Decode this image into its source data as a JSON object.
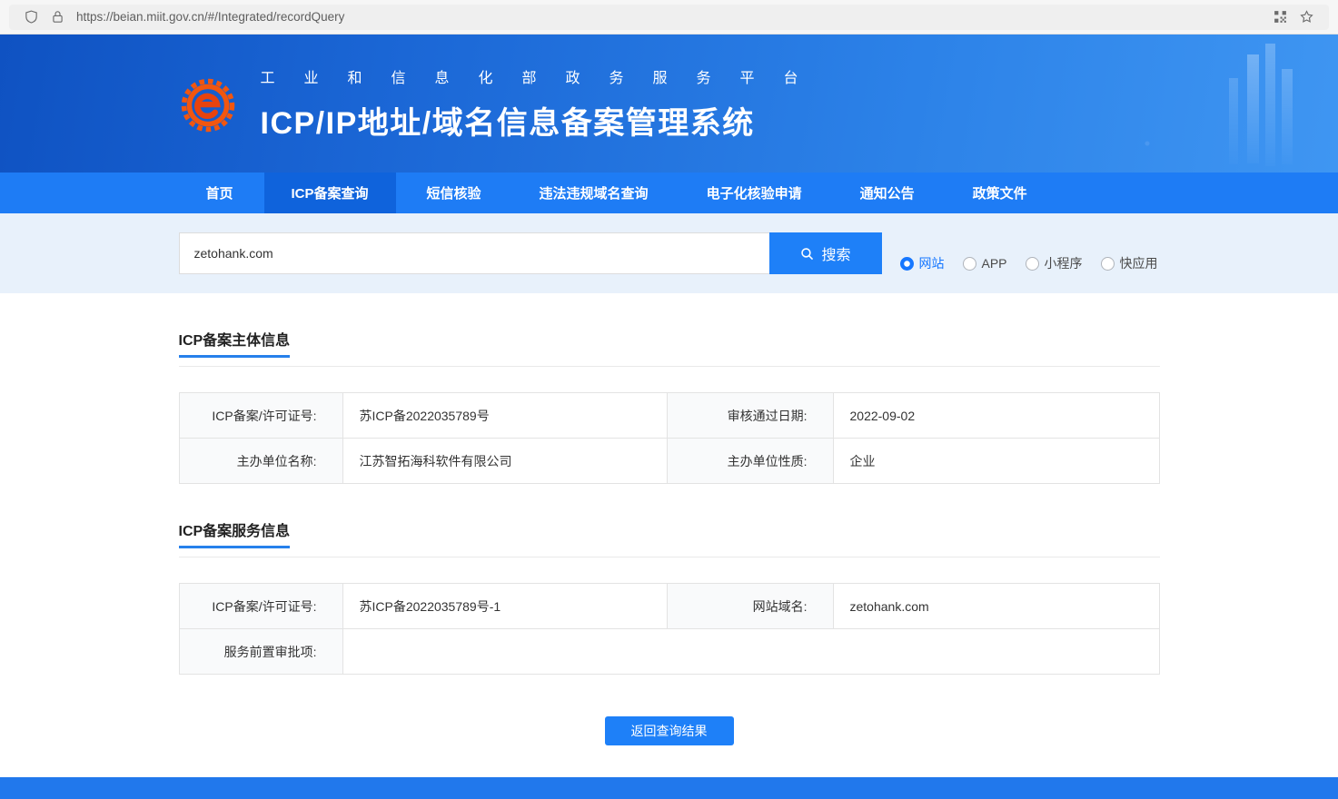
{
  "browser": {
    "url": "https://beian.miit.gov.cn/#/Integrated/recordQuery"
  },
  "header": {
    "subtitle": "工业和信息化部政务服务平台",
    "title": "ICP/IP地址/域名信息备案管理系统"
  },
  "nav": {
    "active": "ICP备案查询",
    "items": [
      {
        "label": "首页"
      },
      {
        "label": "ICP备案查询"
      },
      {
        "label": "短信核验"
      },
      {
        "label": "违法违规域名查询"
      },
      {
        "label": "电子化核验申请"
      },
      {
        "label": "通知公告"
      },
      {
        "label": "政策文件"
      }
    ]
  },
  "search": {
    "value": "zetohank.com",
    "button_label": "搜索",
    "types": [
      {
        "label": "网站",
        "selected": true
      },
      {
        "label": "APP",
        "selected": false
      },
      {
        "label": "小程序",
        "selected": false
      },
      {
        "label": "快应用",
        "selected": false
      }
    ]
  },
  "subject_section": {
    "title": "ICP备案主体信息",
    "rows": [
      {
        "label1": "ICP备案/许可证号:",
        "value1": "苏ICP备2022035789号",
        "label2": "审核通过日期:",
        "value2": "2022-09-02"
      },
      {
        "label1": "主办单位名称:",
        "value1": "江苏智拓海科软件有限公司",
        "label2": "主办单位性质:",
        "value2": "企业"
      }
    ]
  },
  "service_section": {
    "title": "ICP备案服务信息",
    "rows": [
      {
        "label1": "ICP备案/许可证号:",
        "value1": "苏ICP备2022035789号-1",
        "label2": "网站域名:",
        "value2": "zetohank.com"
      },
      {
        "label1": "服务前置审批项:",
        "value1": ""
      }
    ]
  },
  "actions": {
    "back_button": "返回查询结果"
  },
  "colors": {
    "accent": "#1677ff",
    "nav_bg": "#1e7cf5",
    "nav_active": "#0f63dc",
    "search_section_bg": "#e8f1fb",
    "header_blue": "#1b67d6",
    "button_blue": "#1e80f8"
  }
}
